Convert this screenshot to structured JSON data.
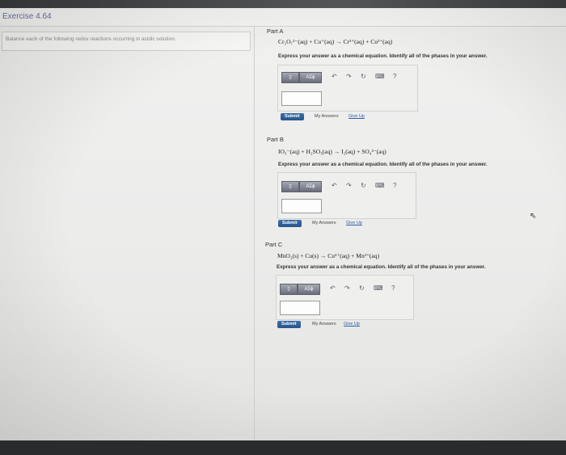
{
  "page": {
    "title": "Exercise 4.64"
  },
  "instructions": "Balance each of the following redox reactions occurring in acidic solution.",
  "parts": [
    {
      "label": "Part A",
      "equation": "Cr₂O₇²⁻(aq) + Cu⁺(aq) → Cr³⁺(aq) + Cu²⁺(aq)",
      "prompt": "Express your answer as a chemical equation. Identify all of the phases in your answer.",
      "submit": "Submit",
      "my_answers": "My Answers",
      "give_up": "Give Up"
    },
    {
      "label": "Part B",
      "equation": "IO₃⁻(aq) + H₂SO₃(aq) → I₂(aq) + SO₄²⁻(aq)",
      "prompt": "Express your answer as a chemical equation. Identify all of the phases in your answer.",
      "submit": "Submit",
      "my_answers": "My Answers",
      "give_up": "Give Up"
    },
    {
      "label": "Part C",
      "equation": "MnO₂(s) + Cu(s) → Cu²⁺(aq) + Mn²⁺(aq)",
      "prompt": "Express your answer as a chemical equation. Identify all of the phases in your answer.",
      "submit": "Submit",
      "my_answers": "My Answers",
      "give_up": "Give Up"
    }
  ],
  "toolbar": {
    "template_label": "▯",
    "greek_label": "ΑΣϕ",
    "undo_icon": "↶",
    "redo_icon": "↷",
    "reset_icon": "↻",
    "keyboard_icon": "⌨",
    "help_label": "?"
  },
  "icons": [
    "undo-icon",
    "redo-icon",
    "reset-icon",
    "keyboard-icon",
    "help-icon",
    "cursor-icon"
  ]
}
